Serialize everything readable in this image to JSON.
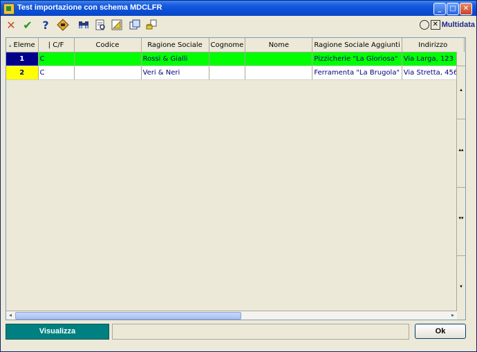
{
  "window": {
    "title": "Test importazione con schema MDCLFR",
    "minimize_glyph": "_",
    "maximize_glyph": "□",
    "close_glyph": "✕"
  },
  "toolbar": {
    "cancel_glyph": "✕",
    "confirm_glyph": "✔",
    "help_glyph": "?",
    "brand_name": "Multidata",
    "brand_box_glyph": "✕"
  },
  "grid": {
    "sort_glyph": "▴",
    "columns": [
      "Eleme",
      "| C/F",
      "Codice",
      "Ragione Sociale",
      "Cognome",
      "Nome",
      "Ragione Sociale Aggiunti",
      "Indirizzo"
    ],
    "rows": [
      {
        "num": "1",
        "cf": "C",
        "codice": "",
        "ragione_sociale": "Rossi & Gialli",
        "cognome": "",
        "nome": "",
        "ragione_sociale_agg": "Pizzicherie \"La Gloriosa\"",
        "indirizzo": "Via Larga, 123"
      },
      {
        "num": "2",
        "cf": "C",
        "codice": "",
        "ragione_sociale": "Veri & Neri",
        "cognome": "",
        "nome": "",
        "ragione_sociale_agg": "Ferramenta \"La Brugola\"",
        "indirizzo": "Via Stretta, 456"
      }
    ],
    "scroll_up_glyph": "▴",
    "scroll_mid_glyph_a": "▴▴",
    "scroll_mid_glyph_b": "▾▾",
    "scroll_down_glyph": "▾",
    "hscroll_left_glyph": "◂",
    "hscroll_right_glyph": "▸"
  },
  "footer": {
    "visualizza_label": "Visualizza",
    "status_text": "",
    "ok_label": "Ok"
  },
  "colors": {
    "row1_background": "#00ff00",
    "row1_index_background": "#00008b",
    "row2_index_background": "#ffff00",
    "visualizza_background": "#008080",
    "title_bar": "#0a50d8"
  }
}
